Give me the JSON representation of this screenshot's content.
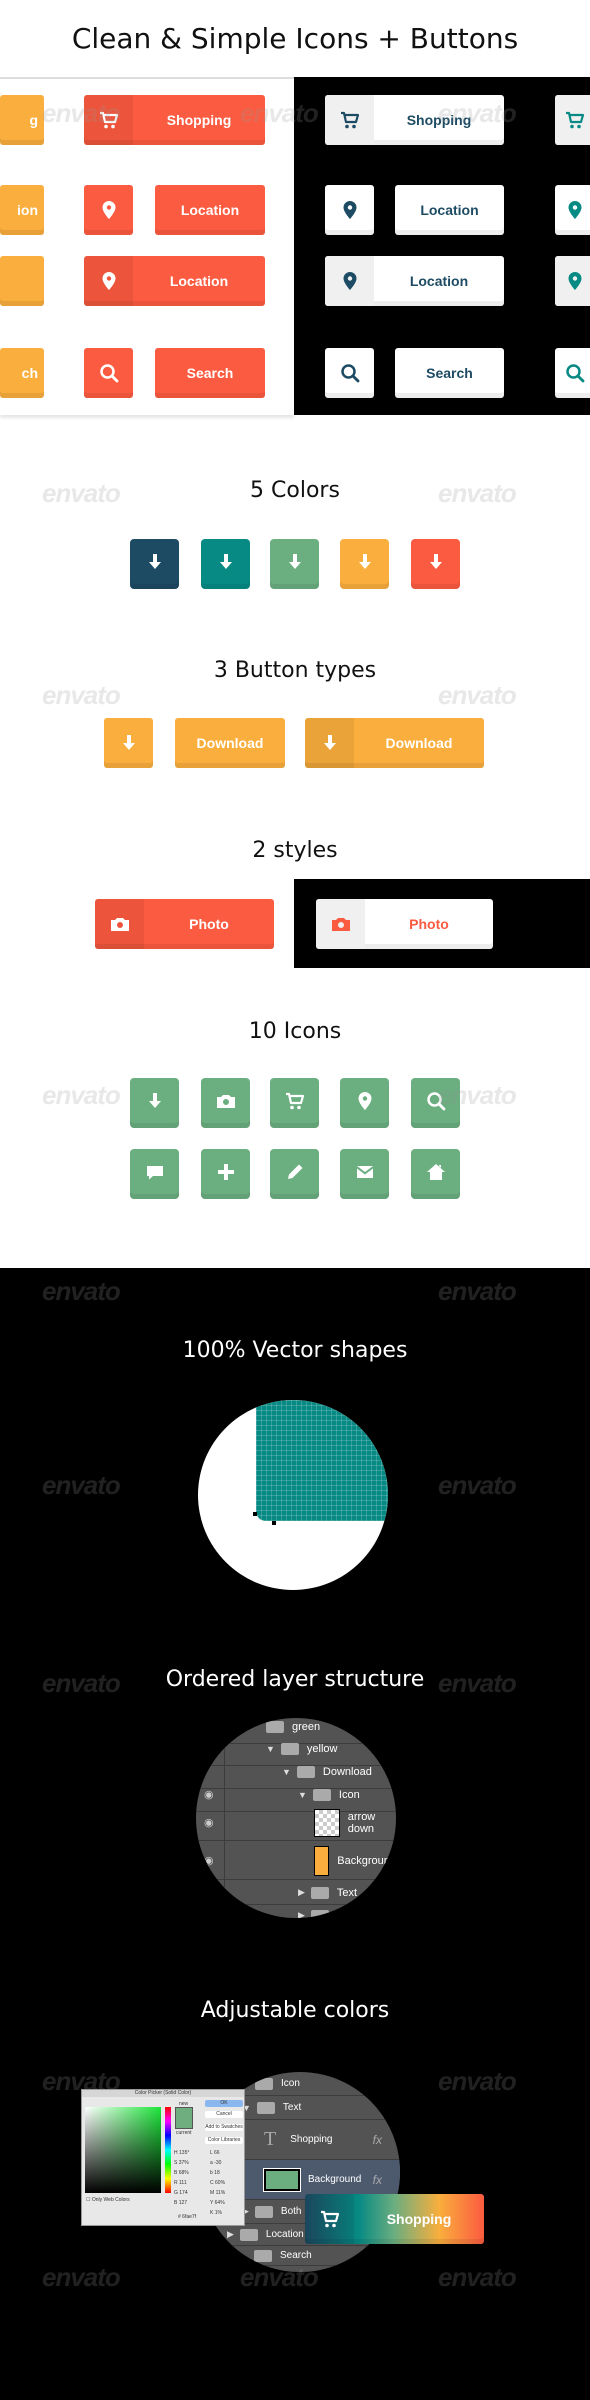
{
  "title": "Clean & Simple Icons + Buttons",
  "colors": {
    "dark_blue": "#1d4b63",
    "teal": "#078a84",
    "green": "#6bae7f",
    "orange": "#f9ae3d",
    "red": "#fb5b40"
  },
  "watermark": "envato",
  "hero": {
    "partial_labels": [
      "g",
      "ion",
      "",
      "ch"
    ],
    "rows": [
      {
        "label": "Shopping",
        "icon": "cart-icon",
        "type": "combo"
      },
      {
        "label": "Location",
        "icon": "pin-icon",
        "type": "separate"
      },
      {
        "label": "Location",
        "icon": "pin-icon",
        "type": "combo"
      },
      {
        "label": "Search",
        "icon": "search-icon",
        "type": "separate"
      }
    ]
  },
  "sections": {
    "colors": "5 Colors",
    "button_types": "3 Button types",
    "styles": "2 styles",
    "icons": "10 Icons",
    "vector": "100% Vector shapes",
    "layers": "Ordered layer structure",
    "adjustable": "Adjustable colors"
  },
  "button_types": {
    "download": "Download"
  },
  "styles": {
    "photo": "Photo"
  },
  "icons": [
    "arrow-down-icon",
    "camera-icon",
    "cart-icon",
    "pin-icon",
    "search-icon",
    "chat-icon",
    "plus-icon",
    "pencil-icon",
    "mail-icon",
    "home-icon"
  ],
  "layers": [
    "green",
    "yellow",
    "Download",
    "Icon",
    "arrow down",
    "Background",
    "Text",
    "Both"
  ],
  "color_layers": [
    "Icon",
    "Text",
    "Shopping",
    "Background",
    "Both",
    "Location",
    "Search"
  ],
  "color_layers_fx": "fx",
  "color_picker": {
    "title": "Color Picker (Solid Color)",
    "ok": "OK",
    "cancel": "Cancel",
    "add": "Add to Swatches",
    "libraries": "Color Libraries",
    "new": "new",
    "current": "current",
    "web_only": "Only Web Colors",
    "fields": [
      [
        "H",
        "135",
        "°"
      ],
      [
        "S",
        "37",
        "%"
      ],
      [
        "B",
        "68",
        "%"
      ],
      [
        "R",
        "111",
        ""
      ],
      [
        "G",
        "174",
        ""
      ],
      [
        "B",
        "127",
        ""
      ]
    ],
    "lab": [
      [
        "L",
        "66"
      ],
      [
        "a",
        "-30"
      ],
      [
        "b",
        "18"
      ]
    ],
    "cmyk": [
      [
        "C",
        "60",
        "%"
      ],
      [
        "M",
        "11",
        "%"
      ],
      [
        "Y",
        "64",
        "%"
      ],
      [
        "K",
        "1",
        "%"
      ]
    ],
    "hex": "6fae7f"
  },
  "gradient_button": {
    "label": "Shopping"
  }
}
